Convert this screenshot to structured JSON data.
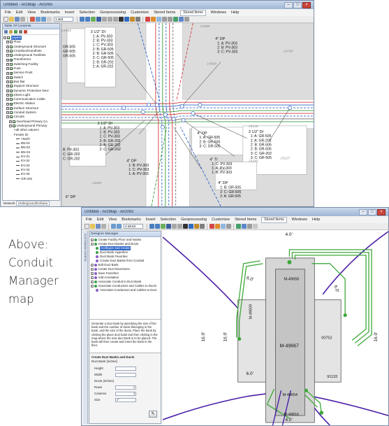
{
  "window1": {
    "title": "Untitled - ArcMap - ArcInfo",
    "menu": [
      "File",
      "Edit",
      "View",
      "Bookmarks",
      "Insert",
      "Selection",
      "Geoprocessing",
      "Customize",
      "Stored Items",
      "Windows",
      "Help"
    ],
    "stored_items_value": "Stored Items",
    "scale": "1:463",
    "toc": {
      "title": "Table Of Contents",
      "items": [
        "Layers",
        "Floor",
        "Underground Structure",
        "Crossbox/Handhole",
        "Underground Facilities",
        "Transformer",
        "Switching Facility",
        "Fuse",
        "Service Point",
        "Switch",
        "Bus Bar",
        "Support Structure",
        "Dynamic Protective Devi",
        "Street Light",
        "Communication Cable",
        "Electric Station",
        "Surface Structure",
        "Conduit System",
        "Circuits",
        "Overhead Primary Co",
        "Underground Primary",
        "<all other values>",
        "Feeder ID",
        "<Null>",
        "BN-01",
        "BN-02",
        "BN-03",
        "EV-31",
        "EV-32",
        "EV-33",
        "EV-34",
        "EV-35",
        "GR-202"
      ]
    },
    "status": {
      "label": "Network",
      "value": "Underground/Urbana"
    },
    "map": {
      "tags": [
        "14583",
        "14588",
        "14738",
        "14588",
        "15126",
        "13669",
        "15243",
        "15326",
        "15127"
      ],
      "labels_conduit": [
        {
          "head": "3 1/2\" DI",
          "lines": [
            "1: A: PV-303",
            "2: B: PV-303",
            "1: C: PV-303",
            "2: B: GR-505",
            "2: B: GR-505",
            "3: C: GR-505",
            "2: B: GR-202",
            "2: A: GR-202"
          ]
        },
        {
          "head": "4\" DP",
          "lines": [
            "1: A: PV-303",
            "2: B: PV-303",
            "3: C: PV-303"
          ]
        },
        {
          "head": "3 1/2\" DI",
          "lines": [
            "1: A: PV-303",
            "1: B: PV-303",
            "1: C: PV-303",
            "2: B: GR-202",
            "2: B: GR-202",
            "2: C: GR-202"
          ]
        },
        {
          "head": "4\" DP",
          "lines": [
            "1: A: GR-505",
            "2: B: GR-505",
            "3: C: GR-505"
          ]
        },
        {
          "head": "3 1/2\" DI",
          "lines": [
            "1: A: GR-505",
            "2: A: GR-202",
            "2: B: GR-505",
            "2: B: GR-505",
            "3: C: GR-202",
            "3: C: GR-505"
          ]
        },
        {
          "head": "4\" TI",
          "lines": [
            "1: C: PV-303",
            "1: A: PV-303",
            "1: B: PV-303"
          ]
        },
        {
          "head": "4\" DP",
          "lines": [
            "1: B: PV-303",
            "1: C: PV-303",
            "1: A: PV-303"
          ]
        },
        {
          "head": "4\" DP",
          "lines": [
            "1: B: GR-505",
            "2: C: GR-505",
            "2: A: GR-505"
          ]
        },
        {
          "head": "6\" DP",
          "lines": []
        }
      ],
      "left_block": [
        "B: PV-303",
        "C: GR-202",
        "C: GR-202"
      ],
      "top_left_partial": [
        "GR-505",
        "GR-505",
        "GR-505"
      ]
    }
  },
  "caption": {
    "lines": [
      "Above:",
      "Conduit",
      "Manager",
      "map"
    ]
  },
  "window2": {
    "title": "Untitled - ArcMap - ArcInfo",
    "menu": [
      "File",
      "Edit",
      "View",
      "Bookmarks",
      "Insert",
      "Selection",
      "Geoprocessing",
      "Customize",
      "Stored Items",
      "Windows",
      "Help"
    ],
    "stored_items_value": "Stored Items",
    "scale": "1:48.63",
    "side_tab": "DUCT/BANK CONFIG",
    "designer": {
      "title": "Designer Manager",
      "tree": [
        {
          "label": "Create Facility Floor and Nodes",
          "color": "#3aa04a",
          "level": 0
        },
        {
          "label": "Create Duct Banks and Ducts",
          "color": "#3aa04a",
          "level": 0
        },
        {
          "label": "Configure and Create",
          "color": "#3aa04a",
          "level": 1,
          "selected": true
        },
        {
          "label": "Duct Bank Hyperline",
          "color": "#3aa04a",
          "level": 1
        },
        {
          "label": "Duct Bank Favorites",
          "color": "#8a5cc7",
          "level": 1
        },
        {
          "label": "Create Duct Banks from Conduit",
          "color": "#8a5cc7",
          "level": 1
        },
        {
          "label": "Edit Duct Bank",
          "color": "#8a5cc7",
          "level": 0
        },
        {
          "label": "Create Duct Diversions",
          "color": "#8a5cc7",
          "level": 0
        },
        {
          "label": "Save Favorites",
          "color": "#8a5cc7",
          "level": 0
        },
        {
          "label": "Add Annotation",
          "color": "#8a5cc7",
          "level": 0
        },
        {
          "label": "Associate Conduit to Duct Bank",
          "color": "#3aa04a",
          "level": 0
        },
        {
          "label": "Associate Conductors and Cables to Ducts",
          "color": "#3aa04a",
          "level": 0
        },
        {
          "label": "Associate Conductors and Cables to Duct",
          "color": "#8a5cc7",
          "level": 1
        }
      ],
      "description": "Generate a duct bank by specifying the size of the bank and the number of ducts belonging in the bank, and the size of the ducts. Place the bank by clicking the place duct bank tool then clicking in the map where the new duct bank is to be placed. The bank will then create and insert the bank in the floor.",
      "form": {
        "title": "Create Duct Banks and Ducts",
        "subtitle": "Duct Bank (inches)",
        "fields": [
          {
            "label": "Height",
            "value": ""
          },
          {
            "label": "Width",
            "value": ""
          },
          {
            "label": "Ducts (inches)",
            "value": null
          },
          {
            "label": "Rows",
            "value": "3"
          },
          {
            "label": "Columns",
            "value": "3"
          },
          {
            "label": "Size",
            "value": "4\""
          }
        ]
      }
    },
    "map": {
      "dims": [
        "6.0'",
        "6.0'",
        "6.0'",
        "16.0'",
        "16.0'",
        "16.0'",
        "4.0'",
        "4.0'"
      ],
      "tags": [
        "M-49667",
        "M-49658",
        "M-49659",
        "M-49654",
        "M-49816",
        "00752",
        "00753",
        "91133"
      ]
    }
  }
}
